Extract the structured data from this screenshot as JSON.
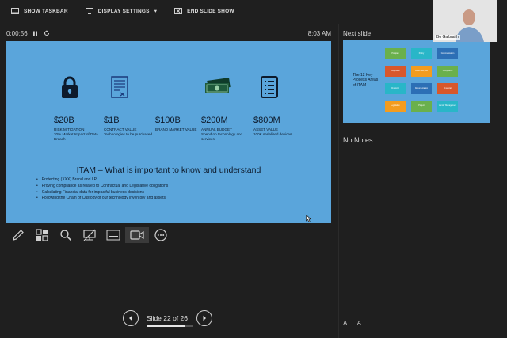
{
  "topbar": {
    "show_taskbar": "SHOW TASKBAR",
    "display_settings": "DISPLAY SETTINGS",
    "display_settings_arrow": "▾",
    "end_slide_show": "END SLIDE SHOW"
  },
  "timer": {
    "elapsed": "0:00:56",
    "clock": "8:03 AM"
  },
  "slide": {
    "stats": [
      {
        "icon": "padlock-icon",
        "value": "$20B",
        "desc": "RISK MITIGATION\n20% Market Impact of Data Breach"
      },
      {
        "icon": "document-icon",
        "value": "$1B",
        "desc": "CONTRACT VALUE\nTechnologies to be purchased"
      },
      {
        "icon": "",
        "value": "$100B",
        "desc": "BRAND MARKET VALUE"
      },
      {
        "icon": "cash-icon",
        "value": "$200M",
        "desc": "ANNUAL BUDGET\nSpend on technology and services"
      },
      {
        "icon": "list-icon",
        "value": "$800M",
        "desc": "ASSET VALUE\n100K serialised devices"
      }
    ],
    "title": "ITAM – What is important to know and understand",
    "bullets": [
      "Protecting (XXX) Brand and I.P.",
      "Proving compliance as related to Contractual and Legislative obligations",
      "Calculating Financial data for impactful business decisions",
      "Following the Chain of Custody of our technology inventory and assets"
    ]
  },
  "navigation": {
    "slide_label": "Slide 22 of 26",
    "current": 22,
    "total": 26
  },
  "next_slide": {
    "label": "Next slide",
    "title": "The 12 Key Process Areas of ITAM",
    "boxes": [
      {
        "label": "Program",
        "color": "#6ab04c"
      },
      {
        "label": "Policy",
        "color": "#29b6c8"
      },
      {
        "label": "Communication",
        "color": "#2c6fb5"
      },
      {
        "label": "Acquisition",
        "color": "#d8582b"
      },
      {
        "label": "Asset Lifecycle",
        "color": "#f39c1f"
      },
      {
        "label": "Compliance",
        "color": "#6ab04c"
      },
      {
        "label": "Financial",
        "color": "#29b6c8"
      },
      {
        "label": "Documentation",
        "color": "#2c6fb5"
      },
      {
        "label": "Financial",
        "color": "#d8582b"
      },
      {
        "label": "Legislation",
        "color": "#f39c1f"
      },
      {
        "label": "Project",
        "color": "#6ab04c"
      },
      {
        "label": "Vendor Management",
        "color": "#29b6c8"
      }
    ]
  },
  "notes": {
    "text": "No Notes."
  },
  "font_controls": {
    "increase": "A",
    "decrease": "A"
  },
  "video": {
    "name": "Bo Galbraith"
  }
}
